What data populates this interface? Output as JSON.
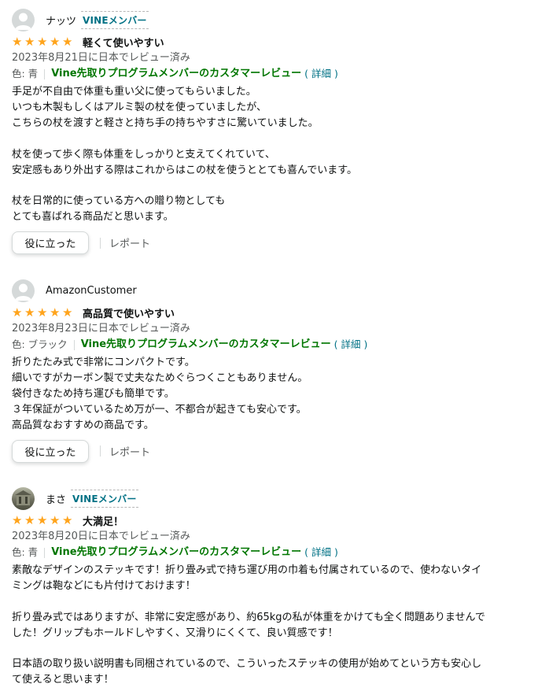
{
  "colors": {
    "star": "#FFA41C",
    "vine_link": "#007600",
    "link": "#007185"
  },
  "reviews": [
    {
      "name": "ナッツ",
      "badge": "VINEメンバー",
      "rating": 5,
      "title": "軽くて使いやすい",
      "date": "2023年8月21日に日本でレビュー済み",
      "variant": "色: 青",
      "vine_label": "Vine先取りプログラムメンバーのカスタマーレビュー",
      "detail": "( 詳細 )",
      "lines": [
        "手足が不自由で体重も重い父に使ってもらいました。",
        "いつも木製もしくはアルミ製の杖を使っていましたが、",
        "こちらの杖を渡すと軽さと持ち手の持ちやすさに驚いていました。",
        "",
        "杖を使って歩く際も体重をしっかりと支えてくれていて、",
        "安定感もあり外出する際はこれからはこの杖を使うととても喜んでいます。",
        "",
        "杖を日常的に使っている方への贈り物としても",
        "とても喜ばれる商品だと思います。"
      ],
      "helpful": "役に立った",
      "report": "レポート"
    },
    {
      "name": "AmazonCustomer",
      "rating": 5,
      "title": "高品質で使いやすい",
      "date": "2023年8月23日に日本でレビュー済み",
      "variant": "色: ブラック",
      "vine_label": "Vine先取りプログラムメンバーのカスタマーレビュー",
      "detail": "( 詳細 )",
      "lines": [
        "折りたたみ式で非常にコンパクトです。",
        "細いですがカーボン製で丈夫なためぐらつくこともありません。",
        "袋付きなため持ち運びも簡単です。",
        "３年保証がついているため万が一、不都合が起きても安心です。",
        "高品質なおすすめの商品です。"
      ],
      "helpful": "役に立った",
      "report": "レポート"
    },
    {
      "name": "まさ",
      "badge": "VINEメンバー",
      "rating": 5,
      "title": "大満足！",
      "date": "2023年8月20日に日本でレビュー済み",
      "variant": "色: 青",
      "vine_label": "Vine先取りプログラムメンバーのカスタマーレビュー",
      "detail": "( 詳細 )",
      "lines": [
        "素敵なデザインのステッキです！折り畳み式で持ち運び用の巾着も付属されているので、使わないタイ",
        "ミングは鞄などにも片付けておけます！",
        "",
        "折り畳み式ではありますが、非常に安定感があり、約65kgの私が体重をかけても全く問題ありませんで",
        "した！グリップもホールドしやすく、又滑りにくくて、良い質感です！",
        "",
        "日本語の取り扱い説明書も同梱されているので、こういったステッキの使用が始めてという方も安心し",
        "て使えると思います！"
      ]
    }
  ]
}
